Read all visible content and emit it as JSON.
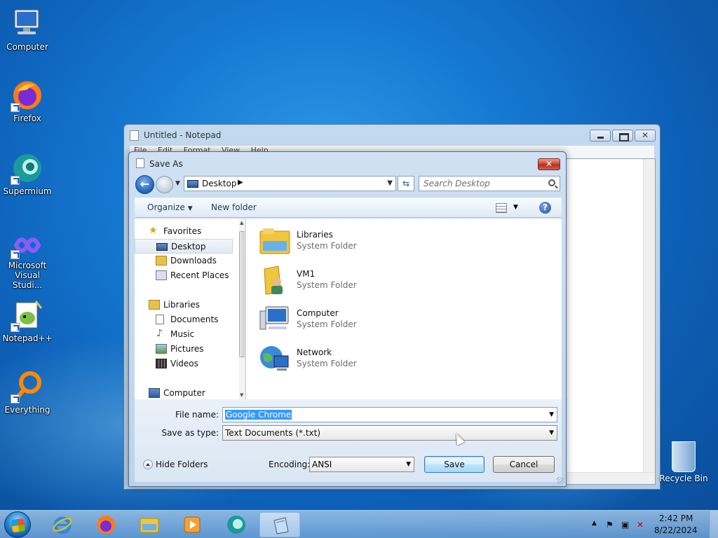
{
  "desktop": {
    "icons": [
      {
        "label": "Computer"
      },
      {
        "label": "Firefox"
      },
      {
        "label": "Supermium"
      },
      {
        "label": "Microsoft Visual Studio...",
        "line1": "Microsoft",
        "line2": "Visual Studi..."
      },
      {
        "label": "Notepad++"
      },
      {
        "label": "Everything"
      }
    ],
    "recycle_bin": "Recycle Bin"
  },
  "notepad": {
    "title": "Untitled - Notepad",
    "menu": [
      "File",
      "Edit",
      "Format",
      "View",
      "Help"
    ]
  },
  "dialog": {
    "title": "Save As",
    "address": "Desktop",
    "search_placeholder": "Search Desktop",
    "toolbar": {
      "organize": "Organize",
      "new_folder": "New folder"
    },
    "nav": {
      "favorites": "Favorites",
      "desktop": "Desktop",
      "downloads": "Downloads",
      "recent": "Recent Places",
      "libraries": "Libraries",
      "documents": "Documents",
      "music": "Music",
      "pictures": "Pictures",
      "videos": "Videos",
      "computer": "Computer"
    },
    "files": [
      {
        "name": "Libraries",
        "type": "System Folder"
      },
      {
        "name": "VM1",
        "type": "System Folder"
      },
      {
        "name": "Computer",
        "type": "System Folder"
      },
      {
        "name": "Network",
        "type": "System Folder"
      }
    ],
    "file_name_label": "File name:",
    "file_name_value": "Google Chrome",
    "save_type_label": "Save as type:",
    "save_type_value": "Text Documents (*.txt)",
    "hide_folders": "Hide Folders",
    "encoding_label": "Encoding:",
    "encoding_value": "ANSI",
    "save_button": "Save",
    "cancel_button": "Cancel"
  },
  "taskbar": {
    "time": "2:42 PM",
    "date": "8/22/2024"
  }
}
